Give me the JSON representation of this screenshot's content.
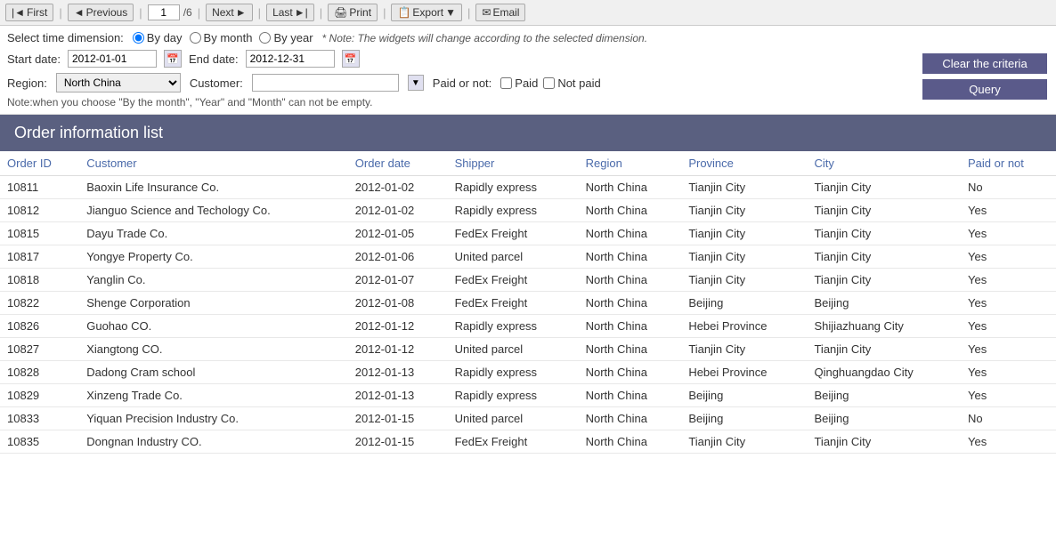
{
  "toolbar": {
    "first_label": "First",
    "previous_label": "Previous",
    "current_page": "1",
    "total_pages": "/6",
    "next_label": "Next",
    "last_label": "Last",
    "print_label": "Print",
    "export_label": "Export",
    "email_label": "Email"
  },
  "filter": {
    "time_dimension_label": "Select time dimension:",
    "by_day_label": "By day",
    "by_month_label": "By month",
    "by_year_label": "By year",
    "note_text": "* Note: The widgets will change according to the selected dimension.",
    "start_date_label": "Start date:",
    "start_date_value": "2012-01-01",
    "end_date_label": "End date:",
    "end_date_value": "2012-12-31",
    "region_label": "Region:",
    "region_value": "North China",
    "customer_label": "Customer:",
    "customer_value": "",
    "paidornot_label": "Paid or not:",
    "paid_label": "Paid",
    "notpaid_label": "Not paid",
    "warning_note": "Note:when you choose \"By the month\", \"Year\" and \"Month\" can not be empty.",
    "clear_btn_label": "Clear the criteria",
    "query_btn_label": "Query"
  },
  "table": {
    "title": "Order information list",
    "columns": [
      "Order ID",
      "Customer",
      "Order date",
      "Shipper",
      "Region",
      "Province",
      "City",
      "Paid or not"
    ],
    "rows": [
      {
        "order_id": "10811",
        "customer": "Baoxin Life Insurance Co.",
        "order_date": "2012-01-02",
        "shipper": "Rapidly express",
        "region": "North China",
        "province": "Tianjin City",
        "city": "Tianjin City",
        "paid_or_not": "No"
      },
      {
        "order_id": "10812",
        "customer": "Jianguo Science and Techology Co.",
        "order_date": "2012-01-02",
        "shipper": "Rapidly express",
        "region": "North China",
        "province": "Tianjin City",
        "city": "Tianjin City",
        "paid_or_not": "Yes"
      },
      {
        "order_id": "10815",
        "customer": "Dayu Trade Co.",
        "order_date": "2012-01-05",
        "shipper": "FedEx Freight",
        "region": "North China",
        "province": "Tianjin City",
        "city": "Tianjin City",
        "paid_or_not": "Yes"
      },
      {
        "order_id": "10817",
        "customer": "Yongye Property Co.",
        "order_date": "2012-01-06",
        "shipper": "United parcel",
        "region": "North China",
        "province": "Tianjin City",
        "city": "Tianjin City",
        "paid_or_not": "Yes"
      },
      {
        "order_id": "10818",
        "customer": "Yanglin Co.",
        "order_date": "2012-01-07",
        "shipper": "FedEx Freight",
        "region": "North China",
        "province": "Tianjin City",
        "city": "Tianjin City",
        "paid_or_not": "Yes"
      },
      {
        "order_id": "10822",
        "customer": "Shenge Corporation",
        "order_date": "2012-01-08",
        "shipper": "FedEx Freight",
        "region": "North China",
        "province": "Beijing",
        "city": "Beijing",
        "paid_or_not": "Yes"
      },
      {
        "order_id": "10826",
        "customer": "Guohao CO.",
        "order_date": "2012-01-12",
        "shipper": "Rapidly express",
        "region": "North China",
        "province": "Hebei Province",
        "city": "Shijiazhuang City",
        "paid_or_not": "Yes"
      },
      {
        "order_id": "10827",
        "customer": "Xiangtong CO.",
        "order_date": "2012-01-12",
        "shipper": "United parcel",
        "region": "North China",
        "province": "Tianjin City",
        "city": "Tianjin City",
        "paid_or_not": "Yes"
      },
      {
        "order_id": "10828",
        "customer": "Dadong Cram school",
        "order_date": "2012-01-13",
        "shipper": "Rapidly express",
        "region": "North China",
        "province": "Hebei Province",
        "city": "Qinghuangdao City",
        "paid_or_not": "Yes"
      },
      {
        "order_id": "10829",
        "customer": "Xinzeng Trade Co.",
        "order_date": "2012-01-13",
        "shipper": "Rapidly express",
        "region": "North China",
        "province": "Beijing",
        "city": "Beijing",
        "paid_or_not": "Yes"
      },
      {
        "order_id": "10833",
        "customer": "Yiquan  Precision Industry Co.",
        "order_date": "2012-01-15",
        "shipper": "United parcel",
        "region": "North China",
        "province": "Beijing",
        "city": "Beijing",
        "paid_or_not": "No"
      },
      {
        "order_id": "10835",
        "customer": "Dongnan Industry CO.",
        "order_date": "2012-01-15",
        "shipper": "FedEx Freight",
        "region": "North China",
        "province": "Tianjin City",
        "city": "Tianjin City",
        "paid_or_not": "Yes"
      }
    ]
  }
}
